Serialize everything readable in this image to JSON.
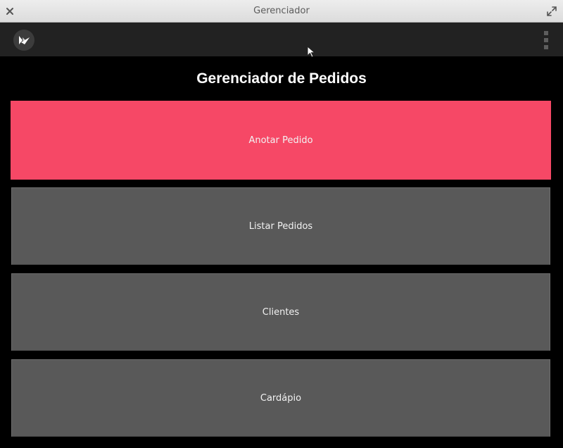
{
  "window": {
    "title": "Gerenciador"
  },
  "main": {
    "title": "Gerenciador de Pedidos",
    "buttons": [
      {
        "label": "Anotar Pedido",
        "state": "active"
      },
      {
        "label": "Listar Pedidos",
        "state": "normal"
      },
      {
        "label": "Clientes",
        "state": "normal"
      },
      {
        "label": "Cardápio",
        "state": "normal"
      }
    ]
  },
  "colors": {
    "accent": "#f64866",
    "button": "#595959",
    "actionbar": "#222222",
    "background": "#000000"
  },
  "icons": {
    "close": "close-icon",
    "maximize": "maximize-icon",
    "logo": "kivy-logo-icon",
    "overflow": "overflow-menu-icon"
  }
}
